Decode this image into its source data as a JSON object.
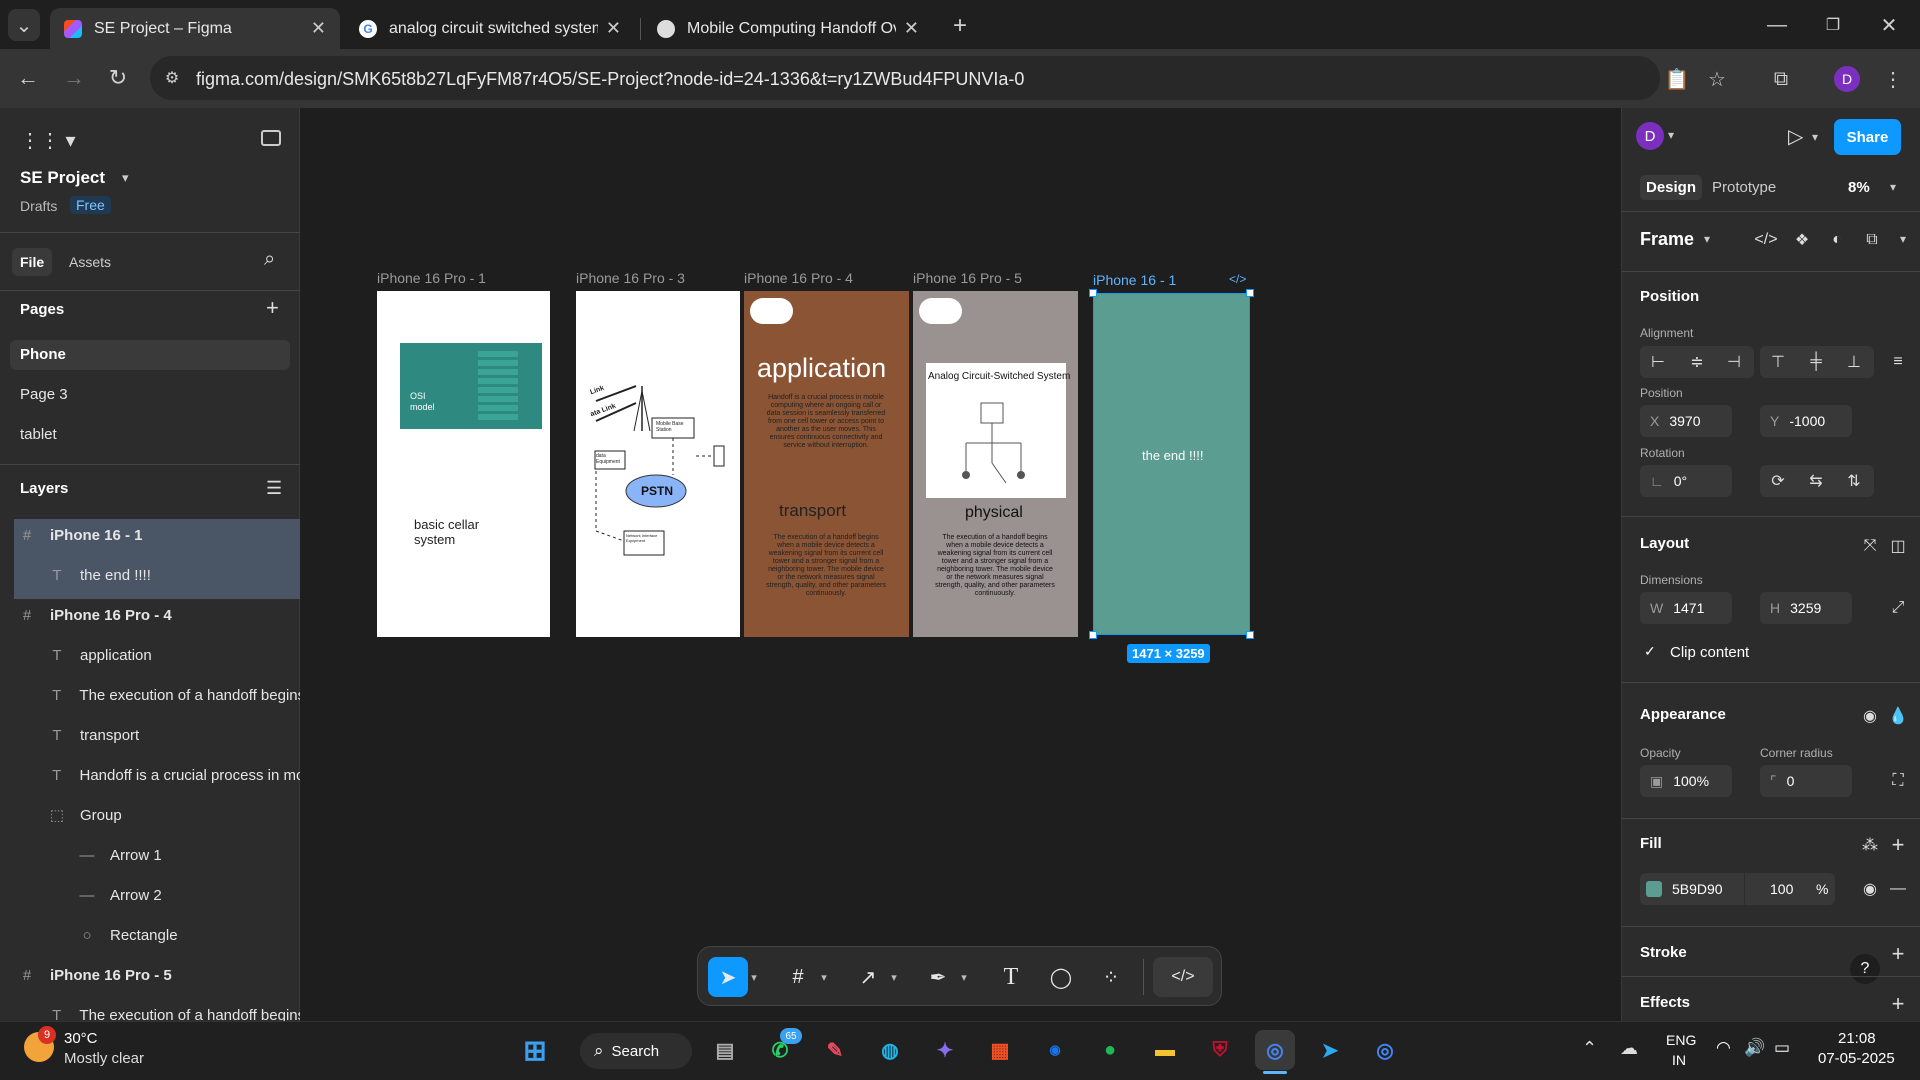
{
  "browser": {
    "tabs": [
      {
        "title": "SE Project – Figma",
        "active": true
      },
      {
        "title": "analog circuit switched system",
        "active": false
      },
      {
        "title": "Mobile Computing Handoff Ov",
        "active": false
      }
    ],
    "url": "figma.com/design/SMK65t8b27LqFyFM87r4O5/SE-Project?node-id=24-1336&t=ry1ZWBud4FPUNVIa-0",
    "profile_initial": "D"
  },
  "figma_left": {
    "project_name": "SE Project",
    "drafts_label": "Drafts",
    "plan_badge": "Free",
    "tabs": {
      "file": "File",
      "assets": "Assets"
    },
    "pages_header": "Pages",
    "pages": [
      "Phone",
      "Page 3",
      "tablet"
    ],
    "layers_header": "Layers",
    "layers": [
      {
        "name": "iPhone 16 - 1",
        "kind": "frame",
        "indent": 0
      },
      {
        "name": "the end !!!!",
        "kind": "text",
        "indent": 1
      },
      {
        "name": "iPhone 16 Pro - 4",
        "kind": "frame",
        "indent": 0
      },
      {
        "name": "application",
        "kind": "text",
        "indent": 1
      },
      {
        "name": "The execution of a handoff begins",
        "kind": "text",
        "indent": 1
      },
      {
        "name": "transport",
        "kind": "text",
        "indent": 1
      },
      {
        "name": "Handoff is a crucial process in mo",
        "kind": "text",
        "indent": 1
      },
      {
        "name": "Group",
        "kind": "group",
        "indent": 1
      },
      {
        "name": "Arrow 1",
        "kind": "line",
        "indent": 2
      },
      {
        "name": "Arrow 2",
        "kind": "line",
        "indent": 2
      },
      {
        "name": "Rectangle",
        "kind": "ellipse",
        "indent": 2
      },
      {
        "name": "iPhone 16 Pro - 5",
        "kind": "frame",
        "indent": 0
      },
      {
        "name": "The execution of a handoff begins",
        "kind": "text",
        "indent": 1
      }
    ]
  },
  "canvas": {
    "frames": [
      {
        "label": "iPhone 16 Pro - 1",
        "osi_label": "OSI model",
        "body_text": "basic cellar system"
      },
      {
        "label": "iPhone 16 Pro - 3",
        "pstn_label": "PSTN",
        "mobile_base_station": "Mobile Base Station",
        "data_equipment": "data Equipment",
        "network_interface": "Network Interface Equipment",
        "link_a": "Link",
        "link_b": "ata Link"
      },
      {
        "label": "iPhone 16 Pro - 4",
        "heading": "application",
        "para1": "Handoff is a crucial process in mobile computing where an ongoing call or data session is seamlessly transferred from one cell tower or access point to another as the user moves. This ensures continuous connectivity and service without interruption.",
        "subheading": "transport",
        "para2": "The execution of a handoff begins when a mobile device detects a weakening signal from its current cell tower and a stronger signal from a neighboring tower. The mobile device or the network measures signal strength, quality, and other parameters continuously."
      },
      {
        "label": "iPhone 16 Pro - 5",
        "image_title": "Analog Circuit-Switched System",
        "heading": "physical",
        "para": "The execution of a handoff begins when a mobile device detects a weakening signal from its current cell tower and a stronger signal from a neighboring tower. The mobile device or the network measures signal strength, quality, and other parameters continuously."
      },
      {
        "label": "iPhone 16 - 1",
        "body_text": "the end !!!!",
        "size_badge": "1471 × 3259",
        "code_icon": "</>"
      }
    ]
  },
  "figma_right": {
    "user_initial": "D",
    "share_label": "Share",
    "tabs": {
      "design": "Design",
      "prototype": "Prototype"
    },
    "zoom": "8%",
    "frame_label": "Frame",
    "position_header": "Position",
    "alignment_label": "Alignment",
    "position_label": "Position",
    "x_prefix": "X",
    "x_value": "3970",
    "y_prefix": "Y",
    "y_value": "-1000",
    "rotation_label": "Rotation",
    "rotation_value": "0°",
    "layout_header": "Layout",
    "dimensions_label": "Dimensions",
    "w_prefix": "W",
    "w_value": "1471",
    "h_prefix": "H",
    "h_value": "3259",
    "clip_content_label": "Clip content",
    "appearance_header": "Appearance",
    "opacity_label": "Opacity",
    "opacity_value": "100%",
    "corner_radius_label": "Corner radius",
    "corner_radius_value": "0",
    "fill_header": "Fill",
    "fill_hex": "5B9D90",
    "fill_opacity": "100",
    "fill_pct": "%",
    "stroke_header": "Stroke",
    "effects_header": "Effects",
    "help": "?"
  },
  "taskbar": {
    "weather_temp": "30°C",
    "weather_desc": "Mostly clear",
    "weather_badge": "9",
    "search_label": "Search",
    "whatsapp_badge": "65",
    "lang_line1": "ENG",
    "lang_line2": "IN",
    "time": "21:08",
    "date": "07-05-2025"
  },
  "colors": {
    "figma_blue": "#0d99ff",
    "frame_teal": "#5B9D90",
    "osi_teal": "#2e8a80",
    "brown": "#8b5434",
    "grey_frame": "#9a9191",
    "selection": "#0d99ff"
  }
}
